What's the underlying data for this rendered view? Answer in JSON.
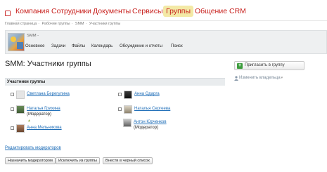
{
  "topnav": {
    "items": [
      {
        "label": "Компания",
        "active": false
      },
      {
        "label": "Сотрудники",
        "active": false
      },
      {
        "label": "Документы",
        "active": false
      },
      {
        "label": "Сервисы",
        "active": false
      },
      {
        "label": "Группы",
        "active": true
      },
      {
        "label": "Общение",
        "active": false
      },
      {
        "label": "CRM",
        "active": false
      }
    ]
  },
  "breadcrumb": [
    "Главная страница",
    "Рабочие группы",
    "SMM",
    "Участники группы"
  ],
  "group": {
    "name": "SMM -",
    "tabs": [
      "Основное",
      "Задачи",
      "Файлы",
      "Календарь",
      "Обсуждение и отчеты",
      "Поиск"
    ]
  },
  "page_title": "SMM: Участники группы",
  "sidebar": {
    "invite_label": "Пригласить в группу",
    "owner_label": "Изменить владельца"
  },
  "members": {
    "header": "Участники группы",
    "list": [
      {
        "name": "Светлана Берегулина",
        "role": ""
      },
      {
        "name": "Анна Одарга",
        "role": ""
      },
      {
        "name": "Наталья Грихина",
        "role": "(Модератор)"
      },
      {
        "name": "Наталья Сергеева",
        "role": ""
      },
      {
        "name": "Антон Юрченков",
        "role": "(Модератор)"
      },
      {
        "name": "Анна Мельникова",
        "role": ""
      }
    ]
  },
  "edit_moderators_label": "Редактировать модераторов",
  "actions": {
    "assign": "Назначить модератором",
    "remove": "Исключить из группы",
    "blacklist": "Внести в черный список"
  },
  "colors": {
    "nav_red": "#c8201d",
    "active_tab_bg": "#f3e9a6",
    "link_blue": "#1f6eb8"
  }
}
